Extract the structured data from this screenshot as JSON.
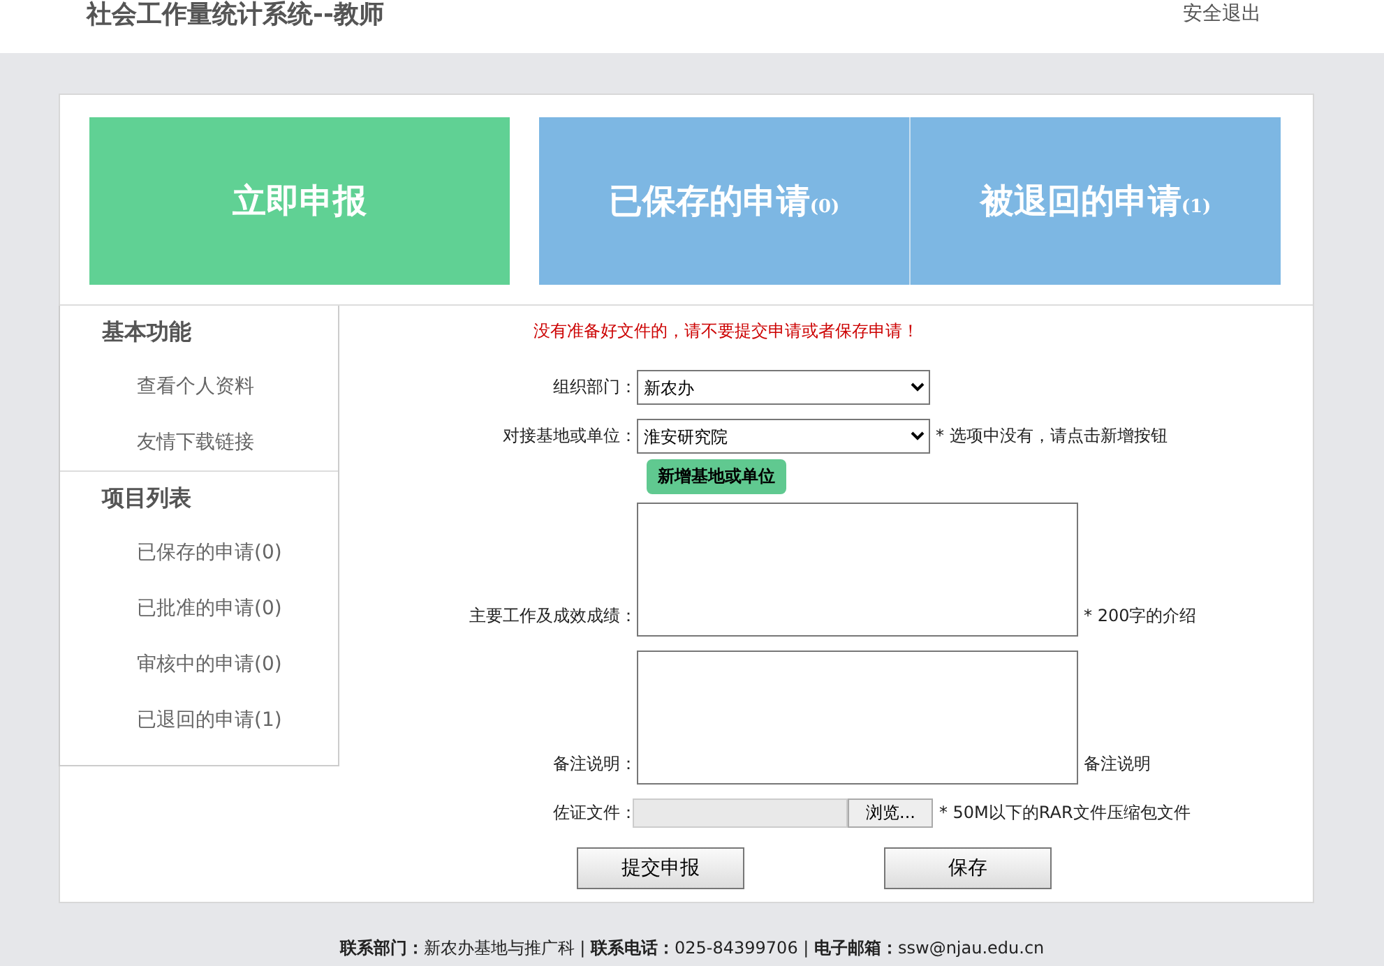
{
  "header": {
    "title": "社会工作量统计系统--教师",
    "logout": "安全退出"
  },
  "tiles": [
    {
      "label": "立即申报",
      "selected": true
    },
    {
      "label": "已保存的申请",
      "count": "(0)",
      "selected": false
    },
    {
      "label": "被退回的申请",
      "count": "(1)",
      "selected": false
    }
  ],
  "sidebar": {
    "sections": [
      {
        "title": "基本功能",
        "items": [
          "查看个人资料",
          "友情下载链接"
        ]
      },
      {
        "title": "项目列表",
        "items": [
          "已保存的申请(0)",
          "已批准的申请(0)",
          "审核中的申请(0)",
          "已退回的申请(1)"
        ]
      }
    ]
  },
  "form": {
    "notice": "没有准备好文件的，请不要提交申请或者保存申请！",
    "fields": [
      {
        "kind": "select",
        "label": "组织部门：",
        "value": "新农办"
      },
      {
        "kind": "select",
        "label": "对接基地或单位：",
        "value": "淮安研究院",
        "hint": "* 选项中没有，请点击新增按钮",
        "action": "新增基地或单位"
      },
      {
        "kind": "textarea",
        "label": "主要工作及成效成绩：",
        "hint": "* 200字的介绍"
      },
      {
        "kind": "textarea",
        "label": "备注说明：",
        "hint": "备注说明"
      },
      {
        "kind": "file",
        "label": "佐证文件：",
        "browse": "浏览...",
        "hint": "* 50M以下的RAR文件压缩包文件"
      }
    ],
    "buttons": [
      "提交申报",
      "保存"
    ]
  },
  "footer": "**联系部门：**新农办基地与推广科 | **联系电话：**025-84399706 | **电子邮箱：**ssw@njau.edu.cn"
}
